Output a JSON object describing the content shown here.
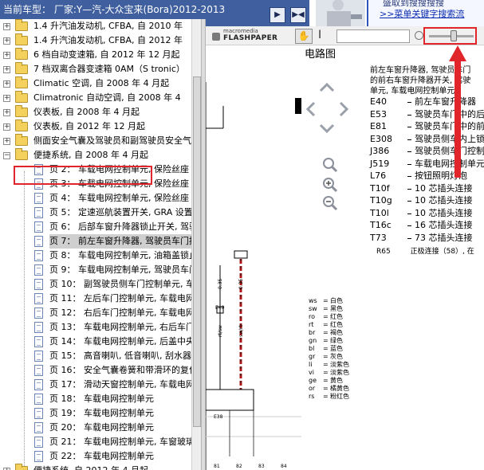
{
  "header": {
    "vehicle_label": "当前车型：  厂家:Y—汽-大众宝来(Bora)2012-2013"
  },
  "ad": {
    "line1": "盛取到搜搜搜搜",
    "link_text": ">>菜单关键字搜索流"
  },
  "tree": {
    "top_items": [
      "1.4 升汽油发动机, CFBA, 自 2010 年",
      "1.4 升汽油发动机, CFBA, 自 2012 年",
      "6 档自动变速箱, 自 2012 年 12 月起",
      "7 档双离合器变速箱 0AM（S tronic）",
      "Climatic 空调, 自 2008 年 4 月起",
      "Climatronic 自动空调, 自 2008 年 4",
      "仪表板, 自 2008 年 4 月起",
      "仪表板, 自 2012 年 12 月起",
      "侧面安全气囊及驾驶员和副驾驶员安全气"
    ],
    "expanded_folder": "便捷系统, 自 2008 年 4 月起",
    "pages": [
      "页 2： 车载电网控制单元, 保险丝座",
      "页 3： 车载电网控制单元, 保险丝座",
      "页 4： 车载电网控制单元, 保险丝座",
      "页 5： 定速巡航装置开关, GRA 设置",
      "页 6： 后部车窗升降器锁止开关, 驾驶",
      "页 7： 前左车窗升降器, 驾驶员车门控",
      "页 8： 车载电网控制单元, 油箱盖锁止",
      "页 9： 车载电网控制单元, 驾驶员车门",
      "页 10： 副驾驶员侧车门控制单元, 车",
      "页 11： 左后车门控制单元, 车载电网",
      "页 12： 右后车门控制单元, 车载电网",
      "页 13： 车载电网控制单元, 右后车门",
      "页 14： 车载电网控制单元, 后盖中央",
      "页 15： 高音喇叭, 低音喇叭, 刮水器",
      "页 16： 安全气囊卷簧和带滑环的复位",
      "页 17： 滑动天窗控制单元, 车载电网",
      "页 18： 车载电网控制单元",
      "页 19： 车载电网控制单元",
      "页 20： 车载电网控制单元",
      "页 21： 车载电网控制单元, 车窗玻璃",
      "页 22： 车载电网控制单元"
    ],
    "selected_page_index": 5,
    "next_folder": "便捷系统, 自 2012 年 4 月起"
  },
  "viewer": {
    "logo_top": "macromedia",
    "logo_main": "FLASHPAPER",
    "diagram_title": "电路图",
    "legend_intro": [
      "前左车窗升降器, 驾驶员车门",
      "的前右车窗升降器开关, 驾驶",
      "单元, 车载电网控制单元"
    ],
    "legend": [
      {
        "code": "E40",
        "desc": "前左车窗升降器"
      },
      {
        "code": "E53",
        "desc": "驾驶员车门中的后"
      },
      {
        "code": "E81",
        "desc": "驾驶员车门中的前"
      },
      {
        "code": "E308",
        "desc": "驾驶员侧车内上锁"
      },
      {
        "code": "J386",
        "desc": "驾驶员侧车门控制"
      },
      {
        "code": "J519",
        "desc": "车载电网控制单元"
      },
      {
        "code": "L76",
        "desc": "按钮照明灯泡"
      },
      {
        "code": "T10f",
        "desc": "10 芯插头连接"
      },
      {
        "code": "T10g",
        "desc": "10 芯插头连接"
      },
      {
        "code": "T10l",
        "desc": "10 芯插头连接"
      },
      {
        "code": "T16c",
        "desc": "16 芯插头连接"
      },
      {
        "code": "T73",
        "desc": "73 芯插头连接"
      }
    ],
    "legend_r65_code": "R65",
    "legend_r65_desc": "正极连接（58）, 在",
    "color_codes": [
      {
        "code": "ws",
        "name": "白色"
      },
      {
        "code": "sw",
        "name": "黑色"
      },
      {
        "code": "ro",
        "name": "红色"
      },
      {
        "code": "rt",
        "name": "红色"
      },
      {
        "code": "br",
        "name": "褐色"
      },
      {
        "code": "gn",
        "name": "绿色"
      },
      {
        "code": "bl",
        "name": "蓝色"
      },
      {
        "code": "gr",
        "name": "灰色"
      },
      {
        "code": "li",
        "name": "淡紫色"
      },
      {
        "code": "vi",
        "name": "淡紫色"
      },
      {
        "code": "ge",
        "name": "黄色"
      },
      {
        "code": "or",
        "name": "橘黄色"
      },
      {
        "code": "rs",
        "name": "粉红色"
      }
    ],
    "schematic_labels": {
      "wire_left": "0.35",
      "wire_right": "0.35",
      "wire_left_color": "rt/sw",
      "wire_right_color": "sw/rt",
      "component": "E40",
      "bottom": [
        "E38",
        "81",
        "82",
        "83",
        "84"
      ]
    }
  },
  "colors": {
    "header_bg": "#3f5f9e",
    "highlight_red": "#e0262a",
    "selection_gray": "#cfcfcf"
  }
}
